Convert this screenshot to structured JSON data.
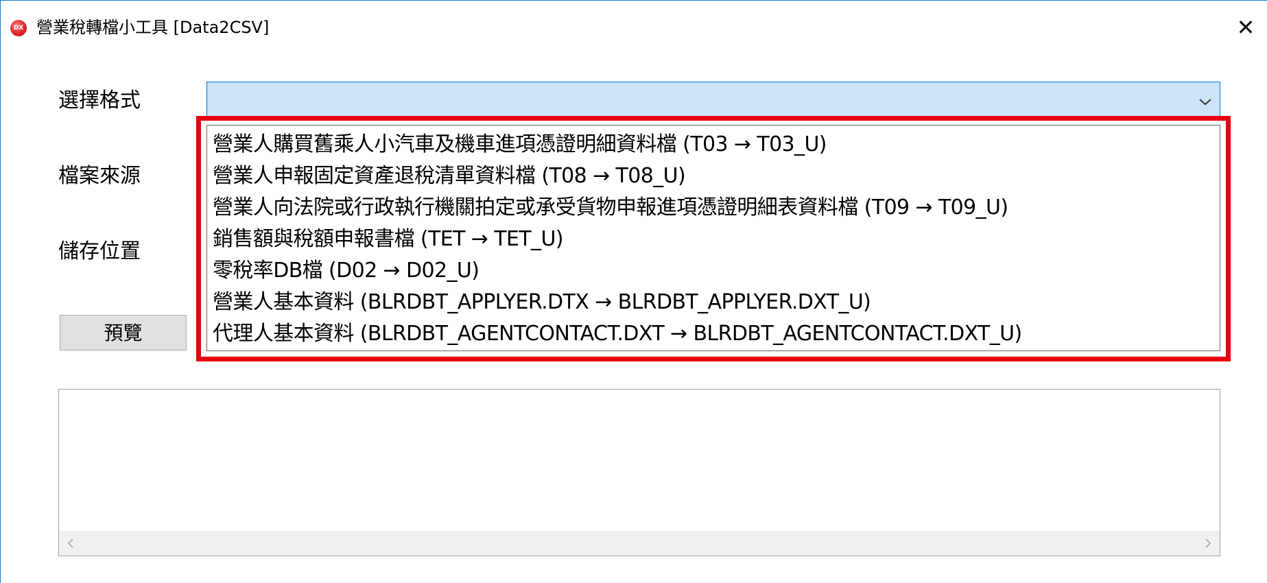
{
  "window": {
    "title": "營業稅轉檔小工具 [Data2CSV]",
    "icon": "app-logo-icon",
    "icon_text": "DX",
    "close_glyph": "✕"
  },
  "form": {
    "format_label": "選擇格式",
    "source_label": "檔案來源",
    "save_label": "儲存位置",
    "preview_button": "預覽",
    "format_select": {
      "selected_value": "",
      "options": [
        "營業人購買舊乘人小汽車及機車進項憑證明細資料檔 (T03 → T03_U)",
        "營業人申報固定資產退稅清單資料檔 (T08 → T08_U)",
        "營業人向法院或行政執行機關拍定或承受貨物申報進項憑證明細表資料檔  (T09 → T09_U)",
        "銷售額與稅額申報書檔  (TET → TET_U)",
        "零稅率DB檔 (D02 → D02_U)",
        "營業人基本資料 (BLRDBT_APPLYER.DTX → BLRDBT_APPLYER.DXT_U)",
        "代理人基本資料 (BLRDBT_AGENTCONTACT.DXT → BLRDBT_AGENTCONTACT.DXT_U)"
      ]
    },
    "output_text": ""
  },
  "colors": {
    "accent": "#0078d7",
    "select_bg": "#cce4f7",
    "highlight": "#e60012",
    "button_bg": "#e1e1e1"
  }
}
